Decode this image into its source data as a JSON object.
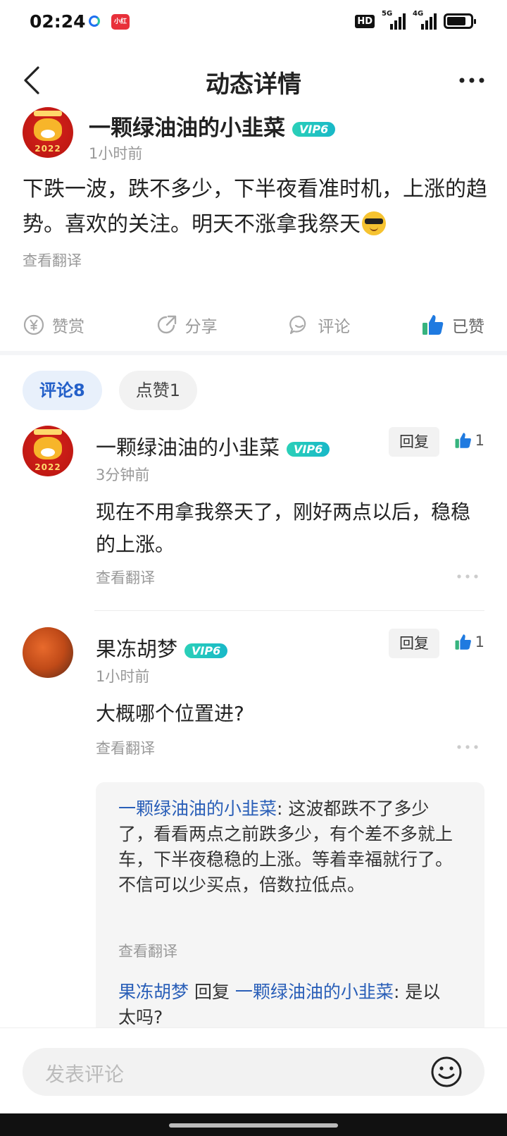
{
  "status": {
    "time": "02:24",
    "app_badge": "小红书",
    "hd": "HD",
    "net1": "5G",
    "net2": "4G",
    "battery_level": 0.8
  },
  "nav": {
    "title": "动态详情"
  },
  "post": {
    "author": "一颗绿油油的小韭菜",
    "vip": "VIP6",
    "time": "1小时前",
    "avatar_year": "2022",
    "body": "下跌一波，跌不多少，下半夜看准时机，上涨的趋势。喜欢的关注。明天不涨拿我祭天",
    "translate": "查看翻译"
  },
  "actions": {
    "reward": "赞赏",
    "share": "分享",
    "comment": "评论",
    "liked": "已赞"
  },
  "tabs": {
    "comments": "评论8",
    "likes": "点赞1"
  },
  "comments": [
    {
      "name": "一颗绿油油的小韭菜",
      "vip": "VIP6",
      "time": "3分钟前",
      "text": "现在不用拿我祭天了，刚好两点以后，稳稳的上涨。",
      "translate": "查看翻译",
      "reply_label": "回复",
      "likes": "1",
      "avatar_year": "2022"
    },
    {
      "name": "果冻胡梦",
      "vip": "VIP6",
      "time": "1小时前",
      "text": "大概哪个位置进?",
      "translate": "查看翻译",
      "reply_label": "回复",
      "likes": "1"
    }
  ],
  "replies": {
    "r1_author": "一颗绿油油的小韭菜",
    "r1_text": ": 这波都跌不了多少了，看看两点之前跌多少，有个差不多就上车，下半夜稳稳的上涨。等着幸福就行了。不信可以少买点，倍数拉低点。",
    "r1_translate": "查看翻译",
    "r2_author": "果冻胡梦",
    "r2_mid": " 回复 ",
    "r2_target": "一颗绿油油的小韭菜",
    "r2_text": ": 是以太吗?"
  },
  "bottom": {
    "placeholder": "发表评论"
  },
  "colors": {
    "accent": "#2460c9",
    "link": "#2a5fb8",
    "vip": "#2bd0b8",
    "thumb": "#1f7ae0"
  }
}
